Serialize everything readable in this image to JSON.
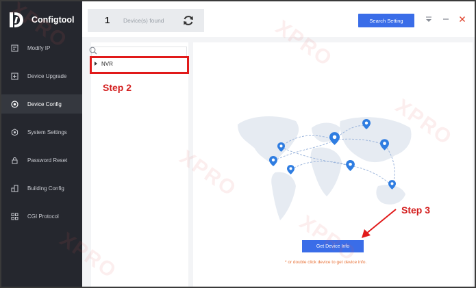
{
  "app": {
    "name": "Configtool"
  },
  "sidebar": {
    "items": [
      {
        "label": "Modify IP",
        "icon": "modify-ip-icon",
        "active": false
      },
      {
        "label": "Device Upgrade",
        "icon": "device-upgrade-icon",
        "active": false
      },
      {
        "label": "Device Config",
        "icon": "device-config-icon",
        "active": true
      },
      {
        "label": "System Settings",
        "icon": "system-settings-icon",
        "active": false
      },
      {
        "label": "Password Reset",
        "icon": "password-reset-icon",
        "active": false
      },
      {
        "label": "Building Config",
        "icon": "building-config-icon",
        "active": false
      },
      {
        "label": "CGI Protocol",
        "icon": "cgi-protocol-icon",
        "active": false
      }
    ]
  },
  "topbar": {
    "device_count": "1",
    "device_found_label": "Device(s) found",
    "search_setting_label": "Search Setting"
  },
  "tree": {
    "search_placeholder": "",
    "nodes": [
      {
        "label": "NVR"
      }
    ]
  },
  "main": {
    "get_device_info_label": "Get Device Info",
    "hint": "* or double click device to get device info."
  },
  "annotations": {
    "step2": "Step 2",
    "step3": "Step 3"
  },
  "watermark": {
    "text": "XPRO"
  },
  "colors": {
    "sidebar_bg": "#25272e",
    "accent": "#3a6de8",
    "annotation_red": "#d31d1d",
    "hint_orange": "#e8743b",
    "map_pin": "#2f7de1"
  }
}
